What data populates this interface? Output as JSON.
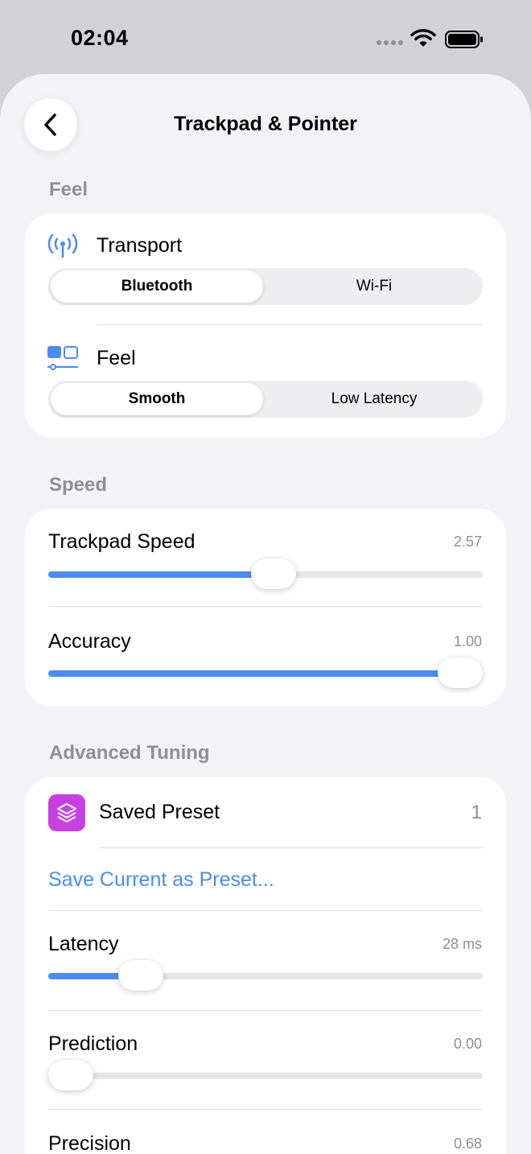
{
  "status": {
    "time": "02:04"
  },
  "nav": {
    "title": "Trackpad & Pointer"
  },
  "sections": {
    "feel": "Feel",
    "speed": "Speed",
    "advanced": "Advanced Tuning"
  },
  "transport": {
    "label": "Transport",
    "options": [
      "Bluetooth",
      "Wi-Fi"
    ],
    "selected": "Bluetooth"
  },
  "feel": {
    "label": "Feel",
    "options": [
      "Smooth",
      "Low Latency"
    ],
    "selected": "Smooth"
  },
  "speed": {
    "trackpad_speed": {
      "label": "Trackpad Speed",
      "value": "2.57",
      "fraction": 0.52
    },
    "accuracy": {
      "label": "Accuracy",
      "value": "1.00",
      "fraction": 1.0
    }
  },
  "advanced": {
    "saved_preset": {
      "label": "Saved Preset",
      "value": "1"
    },
    "save_link": "Save Current as Preset...",
    "latency": {
      "label": "Latency",
      "value": "28 ms",
      "fraction": 0.18
    },
    "prediction": {
      "label": "Prediction",
      "value": "0.00",
      "fraction": 0.0
    },
    "precision": {
      "label": "Precision",
      "value": "0.68"
    }
  },
  "colors": {
    "accent": "#4a8cf0",
    "preset_icon_bg": "#c940e0",
    "background": "#f2f2f7"
  },
  "icons": [
    "back-chevron-icon",
    "antenna-icon",
    "feel-toggle-icon",
    "layers-icon",
    "wifi-icon",
    "battery-icon"
  ]
}
